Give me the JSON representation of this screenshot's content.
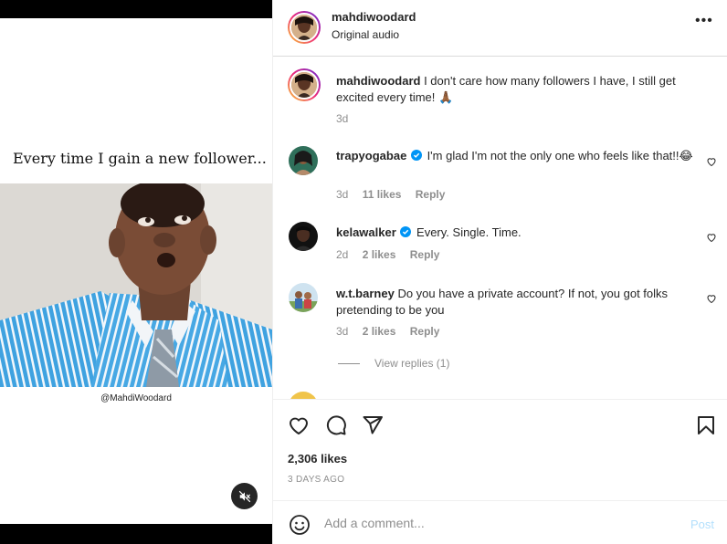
{
  "media": {
    "caption": "Every time I gain a new follower...",
    "watermark": "@MahdiWoodard",
    "mute_icon": "speaker-muted-icon"
  },
  "header": {
    "username": "mahdiwoodard",
    "subtitle": "Original audio",
    "more_label": "•••"
  },
  "post_caption": {
    "username": "mahdiwoodard",
    "text": "I don't care how many followers I have, I still get excited every time! 🙏🏾",
    "age": "3d"
  },
  "comments": [
    {
      "username": "trapyogabae",
      "verified": true,
      "text": "I'm glad I'm not the only one who feels like that!!😂",
      "age": "3d",
      "likes": "11 likes",
      "reply": "Reply"
    },
    {
      "username": "kelawalker",
      "verified": true,
      "text": "Every. Single. Time.",
      "age": "2d",
      "likes": "2 likes",
      "reply": "Reply"
    },
    {
      "username": "w.t.barney",
      "verified": false,
      "text": "Do you have a private account? If not, you got folks pretending to be you",
      "age": "3d",
      "likes": "2 likes",
      "reply": "Reply"
    }
  ],
  "view_replies": "View replies (1)",
  "actions": {
    "likes_count": "2,306 likes",
    "posted": "3 DAYS AGO",
    "icons": [
      "heart-icon",
      "comment-icon",
      "share-icon",
      "bookmark-icon"
    ]
  },
  "composer": {
    "placeholder": "Add a comment...",
    "post_label": "Post"
  },
  "colors": {
    "accent_blue": "#0095f6",
    "post_disabled": "#b2dffc",
    "verified": "#0095f6"
  }
}
